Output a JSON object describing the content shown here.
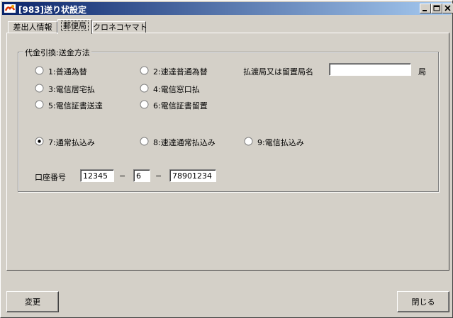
{
  "window": {
    "title": "[983]送り状設定"
  },
  "tabs": [
    {
      "label": "差出人情報",
      "active": false
    },
    {
      "label": "郵便局",
      "active": true
    },
    {
      "label": "クロネコヤマト",
      "active": false
    }
  ],
  "group": {
    "title": "代金引換:送金方法",
    "radios": [
      {
        "label": "1:普通為替",
        "checked": false
      },
      {
        "label": "2:速達普通為替",
        "checked": false
      },
      {
        "label": "3:電信居宅払",
        "checked": false
      },
      {
        "label": "4:電信窓口払",
        "checked": false
      },
      {
        "label": "5:電信証書送達",
        "checked": false
      },
      {
        "label": "6:電信証書留置",
        "checked": false
      },
      {
        "label": "7:通常払込み",
        "checked": true
      },
      {
        "label": "8:速達通常払込み",
        "checked": false
      },
      {
        "label": "9:電信払込み",
        "checked": false
      }
    ],
    "office_label": "払渡局又は留置局名",
    "office_value": "",
    "office_suffix": "局",
    "account_label": "口座番号",
    "account_part1": "12345",
    "account_dash1": "−",
    "account_part2": "6",
    "account_dash2": "−",
    "account_part3": "78901234"
  },
  "buttons": {
    "change": "変更",
    "close": "閉じる"
  }
}
